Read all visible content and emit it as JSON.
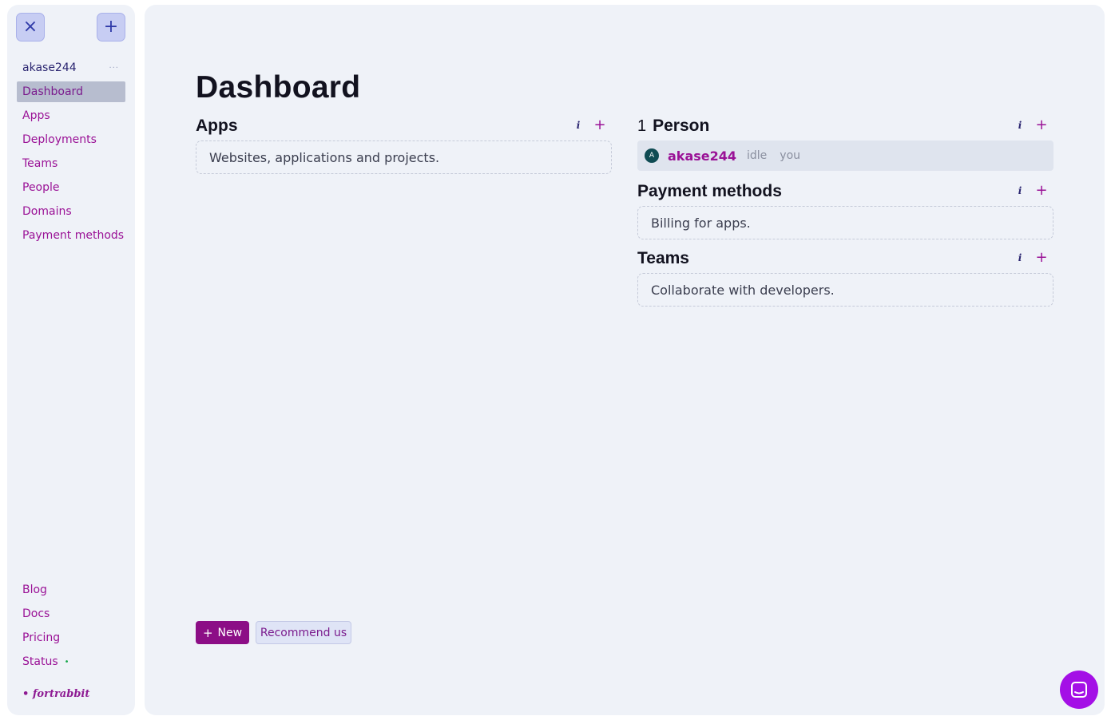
{
  "sidebar": {
    "close_icon": "×",
    "add_icon": "+",
    "user": {
      "label": "akase244",
      "menu_icon": "···"
    },
    "items": [
      {
        "label": "Dashboard",
        "active": true
      },
      {
        "label": "Apps"
      },
      {
        "label": "Deployments"
      },
      {
        "label": "Teams"
      },
      {
        "label": "People"
      },
      {
        "label": "Domains"
      },
      {
        "label": "Payment methods"
      }
    ],
    "bottom_items": [
      {
        "label": "Blog"
      },
      {
        "label": "Docs"
      },
      {
        "label": "Pricing"
      },
      {
        "label": "Status",
        "indicator": "•"
      }
    ],
    "logo": "• fortrabbit"
  },
  "main": {
    "title": "Dashboard",
    "sections": {
      "apps": {
        "title": "Apps",
        "description": "Websites, applications and projects.",
        "info": "i",
        "add": "+"
      },
      "people": {
        "count": "1",
        "title": "Person",
        "info": "i",
        "add": "+",
        "person": {
          "avatar_letter": "A",
          "name": "akase244",
          "status": "idle",
          "tag": "you"
        }
      },
      "payment": {
        "title": "Payment methods",
        "description": "Billing for apps.",
        "info": "i",
        "add": "+"
      },
      "teams": {
        "title": "Teams",
        "description": "Collaborate with developers.",
        "info": "i",
        "add": "+"
      }
    },
    "buttons": {
      "new_icon": "+",
      "new_label": "New",
      "recommend_label": "Recommend us"
    }
  },
  "colors": {
    "accent": "#9a1196",
    "primary_button": "#8c0e86",
    "chat_button": "#a40fe6",
    "status_ok": "#17a84a"
  }
}
